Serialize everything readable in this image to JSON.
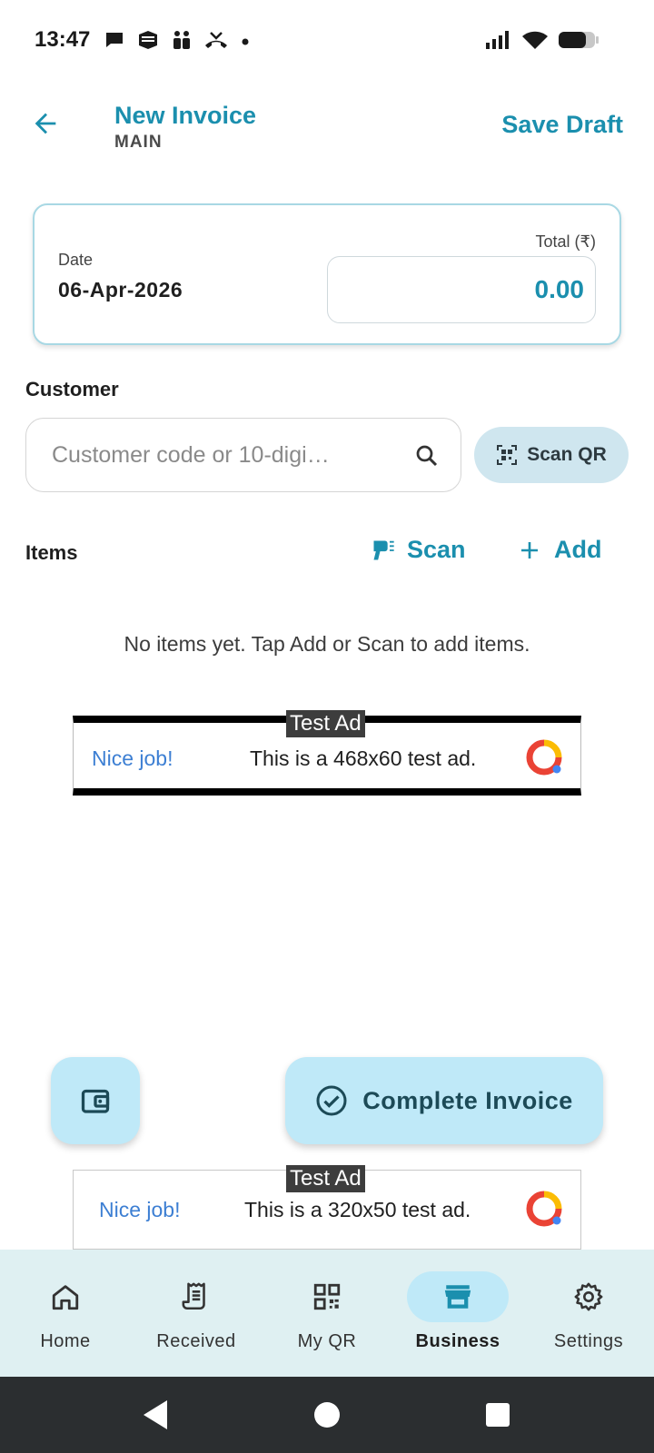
{
  "status_bar": {
    "time": "13:47"
  },
  "header": {
    "title": "New Invoice",
    "subtitle": "MAIN",
    "save_label": "Save Draft"
  },
  "summary": {
    "date_label": "Date",
    "date_value": "06-Apr-2026",
    "total_label": "Total (₹)",
    "total_value": "0.00"
  },
  "customer": {
    "label": "Customer",
    "placeholder": "Customer code or 10-digi…",
    "scan_qr_label": "Scan QR"
  },
  "items": {
    "label": "Items",
    "scan_label": "Scan",
    "add_label": "Add",
    "empty_message": "No items yet. Tap Add or Scan to add items."
  },
  "ads": [
    {
      "tag": "Test Ad",
      "headline": "Nice job!",
      "text": "This is a 468x60 test ad."
    },
    {
      "tag": "Test Ad",
      "headline": "Nice job!",
      "text": "This is a 320x50 test ad."
    }
  ],
  "actions": {
    "complete_label": "Complete Invoice"
  },
  "bottom_nav": [
    {
      "label": "Home",
      "icon": "home-icon"
    },
    {
      "label": "Received",
      "icon": "receipt-icon"
    },
    {
      "label": "My QR",
      "icon": "qr-code-icon"
    },
    {
      "label": "Business",
      "icon": "store-icon",
      "active": true
    },
    {
      "label": "Settings",
      "icon": "gear-icon"
    }
  ],
  "colors": {
    "accent": "#1b8fae",
    "fab_bg": "#bfe9f8",
    "nav_bg": "#dff0f2"
  }
}
